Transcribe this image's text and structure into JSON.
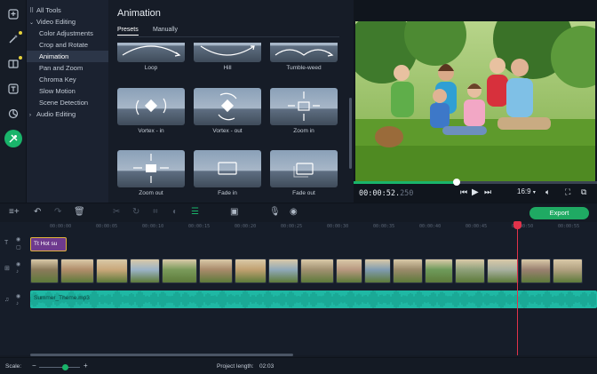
{
  "tools_tree": {
    "items": [
      {
        "label": "All Tools",
        "group": true,
        "icon": "grid-icon"
      },
      {
        "label": "Video Editing",
        "group": true,
        "icon": "chevron-down-icon"
      },
      {
        "label": "Color Adjustments",
        "group": false
      },
      {
        "label": "Crop and Rotate",
        "group": false
      },
      {
        "label": "Animation",
        "group": false,
        "selected": true
      },
      {
        "label": "Pan and Zoom",
        "group": false
      },
      {
        "label": "Chroma Key",
        "group": false
      },
      {
        "label": "Slow Motion",
        "group": false
      },
      {
        "label": "Scene Detection",
        "group": false
      },
      {
        "label": "Audio Editing",
        "group": true,
        "icon": "chevron-right-icon"
      }
    ]
  },
  "animation_panel": {
    "title": "Animation",
    "tabs": [
      "Presets",
      "Manually"
    ],
    "active_tab": "Presets",
    "presets": [
      {
        "label": "Loop",
        "icon": "loop-arc-icon"
      },
      {
        "label": "Hill",
        "icon": "hill-arc-icon"
      },
      {
        "label": "Tumble-weed",
        "icon": "tumbleweed-arc-icon"
      },
      {
        "label": "Vortex - in",
        "icon": "vortex-in-icon"
      },
      {
        "label": "Vortex - out",
        "icon": "vortex-out-icon"
      },
      {
        "label": "Zoom in",
        "icon": "zoom-in-arrows-icon"
      },
      {
        "label": "Zoom out",
        "icon": "zoom-out-arrows-icon"
      },
      {
        "label": "Fade in",
        "icon": "fade-in-icon"
      },
      {
        "label": "Fade out",
        "icon": "fade-out-icon"
      }
    ]
  },
  "player": {
    "timecode_main": "00:00:52.",
    "timecode_ms": "250",
    "progress_fraction": 0.425,
    "aspect_ratio": "16:9",
    "controls": [
      "skip-back-icon",
      "play-icon",
      "skip-forward-icon"
    ],
    "right_controls": [
      "volume-icon",
      "fullscreen-icon",
      "detach-icon"
    ]
  },
  "toolbar": {
    "icons": [
      "undo-icon",
      "redo-icon",
      "trash-icon",
      "cut-icon",
      "rotate-icon",
      "crop-icon",
      "color-icon",
      "clip-properties-icon",
      "overlay-icon",
      "microphone-icon",
      "marker-icon"
    ],
    "export_label": "Export"
  },
  "timeline": {
    "ruler_labels": [
      "00:00:00",
      "00:00:05",
      "00:00:10",
      "00:00:15",
      "00:00:20",
      "00:00:25",
      "00:00:30",
      "00:00:35",
      "00:00:40",
      "00:00:45",
      "00:00:50",
      "00:00:55"
    ],
    "title_clip": "Hot su",
    "audio_clip": "Summer_Theme.mp3",
    "video_clip_count": 17
  },
  "status": {
    "scale_label": "Scale:",
    "project_length_label": "Project length:",
    "project_length_value": "02:03"
  },
  "colors": {
    "accent": "#19b46a",
    "audio": "#1fb8a4",
    "playhead": "#e0324a",
    "title_clip": "#6e3a8e"
  }
}
